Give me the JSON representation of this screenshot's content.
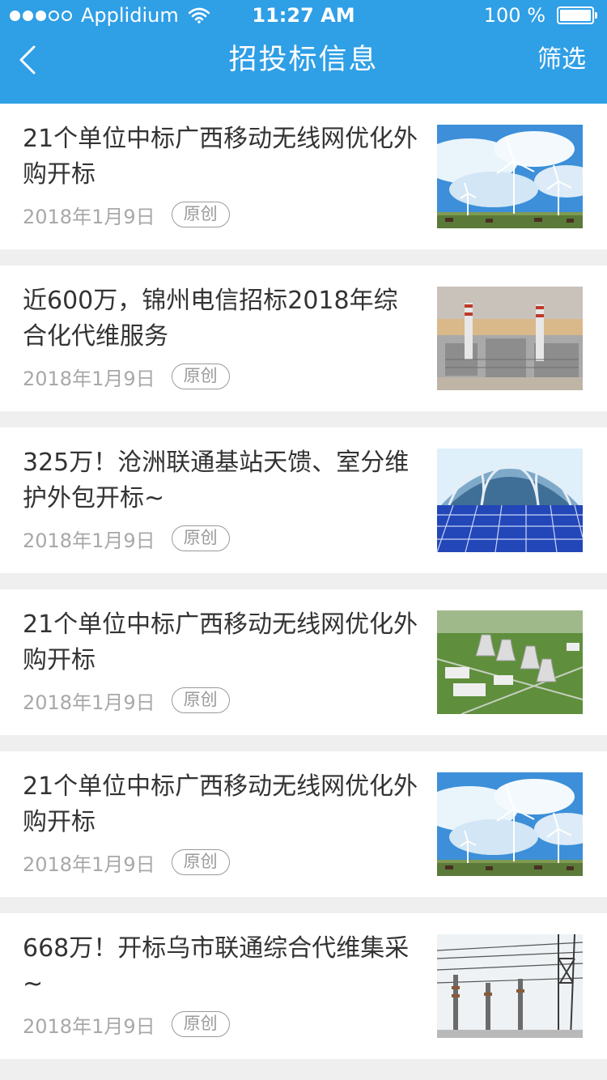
{
  "status_bar": {
    "carrier": "Applidium",
    "time": "11:27 AM",
    "battery_text": "100 %",
    "signal_filled": 3,
    "signal_total": 5
  },
  "nav": {
    "back_icon": "chevron-left-icon",
    "title": "招投标信息",
    "filter_label": "筛选"
  },
  "colors": {
    "header": "#2f9fe6",
    "background": "#efefef",
    "title_text": "#333333",
    "meta_text": "#a8a8a8"
  },
  "articles": [
    {
      "title": "21个单位中标广西移动无线网优化外购开标",
      "date": "2018年1月9日",
      "tag": "原创",
      "image": "wind-turbines"
    },
    {
      "title": "近600万，锦州电信招标2018年综合化代维服务",
      "date": "2018年1月9日",
      "tag": "原创",
      "image": "power-plant"
    },
    {
      "title": "325万！沧洲联通基站天馈、室分维护外包开标~",
      "date": "2018年1月9日",
      "tag": "原创",
      "image": "solar-dome"
    },
    {
      "title": "21个单位中标广西移动无线网优化外购开标",
      "date": "2018年1月9日",
      "tag": "原创",
      "image": "cooling-towers"
    },
    {
      "title": "21个单位中标广西移动无线网优化外购开标",
      "date": "2018年1月9日",
      "tag": "原创",
      "image": "wind-turbines"
    },
    {
      "title": "668万！开标乌市联通综合代维集采~",
      "date": "2018年1月9日",
      "tag": "原创",
      "image": "substation"
    }
  ]
}
